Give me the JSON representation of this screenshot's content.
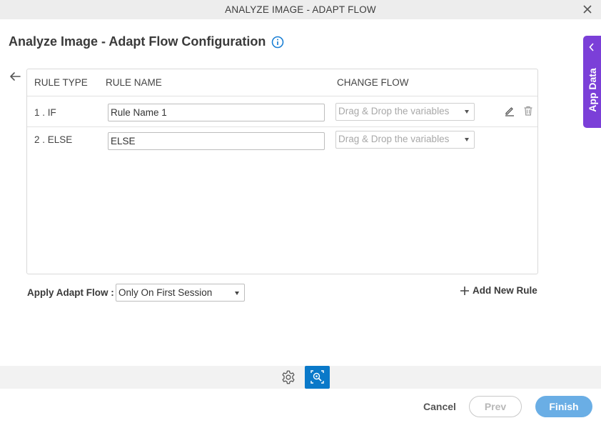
{
  "window": {
    "title": "ANALYZE IMAGE - ADAPT FLOW"
  },
  "page": {
    "heading": "Analyze Image - Adapt Flow Configuration"
  },
  "side_panel": {
    "label": "App Data"
  },
  "rules_table": {
    "columns": {
      "rule_type": "RULE TYPE",
      "rule_name": "RULE NAME",
      "change_flow": "CHANGE FLOW"
    },
    "rows": [
      {
        "rule_type": "1 . IF",
        "rule_name": "Rule Name 1",
        "change_flow_placeholder": "Drag & Drop the variables"
      },
      {
        "rule_type": "2 . ELSE",
        "rule_name": "ELSE",
        "change_flow_placeholder": "Drag & Drop the variables"
      }
    ]
  },
  "apply_adapt_flow": {
    "label": "Apply Adapt Flow :",
    "selected": "Only On First Session"
  },
  "add_rule": {
    "label": "Add New Rule"
  },
  "footer": {
    "cancel": "Cancel",
    "prev": "Prev",
    "finish": "Finish"
  },
  "colors": {
    "accent_purple": "#7b3fd8",
    "primary_blue": "#0a79c9",
    "finish_blue": "#6aaee5",
    "info_blue": "#1a7fd4"
  }
}
